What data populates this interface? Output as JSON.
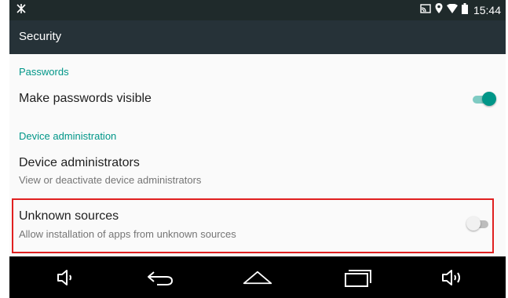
{
  "status_bar": {
    "time": "15:44",
    "icons": [
      "notification-icon",
      "cast-icon",
      "location-icon",
      "wifi-icon",
      "battery-icon"
    ]
  },
  "app_bar": {
    "title": "Security"
  },
  "sections": {
    "passwords": {
      "header": "Passwords",
      "items": {
        "make_passwords_visible": {
          "title": "Make passwords visible",
          "enabled": true
        }
      }
    },
    "device_administration": {
      "header": "Device administration",
      "items": {
        "device_administrators": {
          "title": "Device administrators",
          "summary": "View or deactivate device administrators"
        },
        "unknown_sources": {
          "title": "Unknown sources",
          "summary": "Allow installation of apps from unknown sources",
          "enabled": false
        }
      }
    }
  },
  "nav_bar": {
    "buttons": [
      "volume-down-icon",
      "back-icon",
      "home-icon",
      "recents-icon",
      "volume-up-icon"
    ]
  },
  "colors": {
    "accent": "#009688",
    "app_bar": "#263238",
    "status_bar": "#1f2a2b",
    "highlight": "#e02020"
  }
}
